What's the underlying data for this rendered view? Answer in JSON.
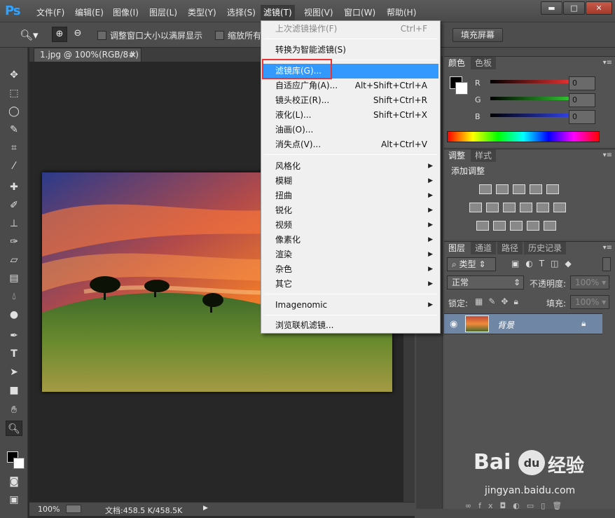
{
  "app": {
    "logo": "Ps"
  },
  "menubar": {
    "items": [
      "文件(F)",
      "编辑(E)",
      "图像(I)",
      "图层(L)",
      "类型(Y)",
      "选择(S)",
      "滤镜(T)",
      "视图(V)",
      "窗口(W)",
      "帮助(H)"
    ],
    "active_index": 6
  },
  "window_controls": {
    "minimize": "▬",
    "maximize": "□",
    "close": "✕"
  },
  "options_bar": {
    "resize_windows_label": "调整窗口大小以满屏显示",
    "zoom_all_label": "缩放所有",
    "fill_screen_button": "填充屏幕"
  },
  "document": {
    "tab_label": "1.jpg @ 100%(RGB/8#)",
    "tab_close": "×",
    "zoom": "100%",
    "doc_info": "文档:458.5 K/458.5K"
  },
  "filter_menu": {
    "last_filter": {
      "label": "上次滤镜操作(F)",
      "shortcut": "Ctrl+F"
    },
    "smart_filter": "转换为智能滤镜(S)",
    "group1": [
      {
        "label": "滤镜库(G)...",
        "shortcut": "",
        "highlighted": true
      },
      {
        "label": "自适应广角(A)...",
        "shortcut": "Alt+Shift+Ctrl+A"
      },
      {
        "label": "镜头校正(R)...",
        "shortcut": "Shift+Ctrl+R"
      },
      {
        "label": "液化(L)...",
        "shortcut": "Shift+Ctrl+X"
      },
      {
        "label": "油画(O)...",
        "shortcut": ""
      },
      {
        "label": "消失点(V)...",
        "shortcut": "Alt+Ctrl+V"
      }
    ],
    "submenus": [
      "风格化",
      "模糊",
      "扭曲",
      "锐化",
      "视频",
      "像素化",
      "渲染",
      "杂色",
      "其它"
    ],
    "plugins": [
      "Imagenomic"
    ],
    "browse_online": "浏览联机滤镜..."
  },
  "color_panel": {
    "tabs": [
      "颜色",
      "色板"
    ],
    "channels": [
      {
        "label": "R",
        "value": "0",
        "color": "#e03030"
      },
      {
        "label": "G",
        "value": "0",
        "color": "#30c030"
      },
      {
        "label": "B",
        "value": "0",
        "color": "#3040e0"
      }
    ]
  },
  "adjustments_panel": {
    "tabs": [
      "调整",
      "样式"
    ],
    "heading": "添加调整"
  },
  "layers_panel": {
    "tabs": [
      "图层",
      "通道",
      "路径",
      "历史记录"
    ],
    "filter_kind": "类型",
    "blend_mode": "正常",
    "opacity_label": "不透明度:",
    "opacity_value": "100%",
    "lock_label": "锁定:",
    "fill_label": "填充:",
    "fill_value": "100%",
    "layers": [
      {
        "name": "背景",
        "visible": true,
        "locked": true
      }
    ]
  },
  "watermark": {
    "brand": "Bai",
    "paw": "du",
    "cn": "经验",
    "url": "jingyan.baidu.com"
  },
  "colors": {
    "highlight": "#3399ff",
    "ps_blue": "#2fa3ff",
    "redbox": "#e33333"
  }
}
